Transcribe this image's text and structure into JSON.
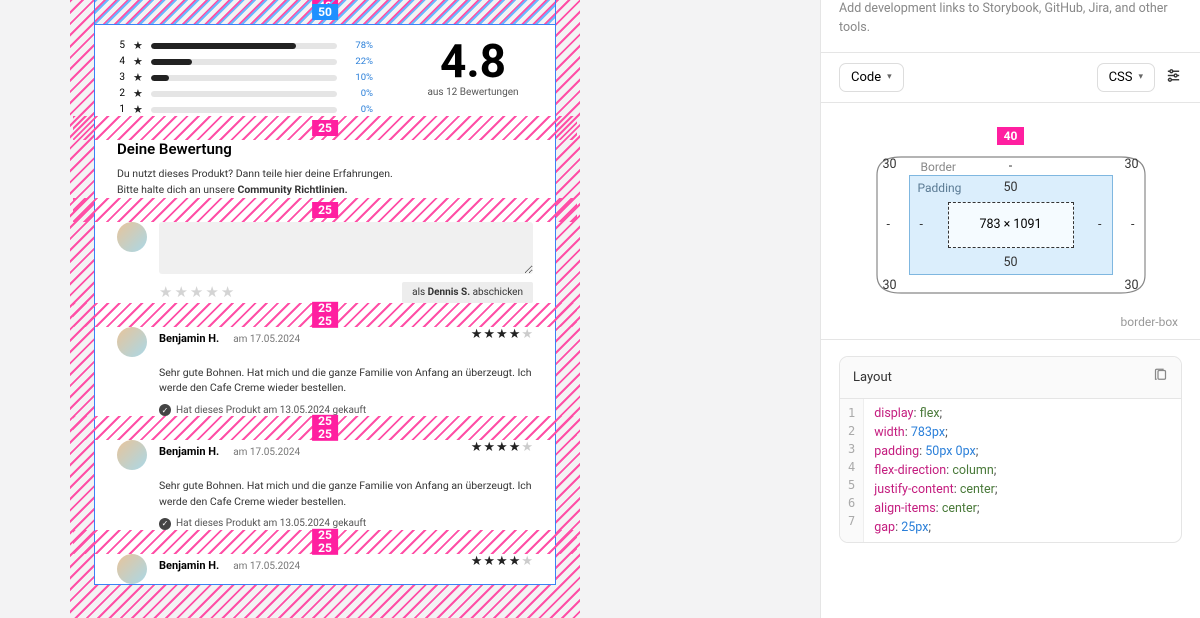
{
  "spacing_labels": {
    "outer_top": "40",
    "frame_top": "50",
    "gap1": "25",
    "gap2": "25",
    "gap3_a": "25",
    "gap3_b": "25",
    "gap4_a": "25",
    "gap4_b": "25",
    "gap5_a": "25",
    "gap5_b": "25",
    "inspector_top": "40"
  },
  "rating": {
    "bars": [
      {
        "label": "5",
        "pct": "78%",
        "fill": 78
      },
      {
        "label": "4",
        "pct": "22%",
        "fill": 22
      },
      {
        "label": "3",
        "pct": "10%",
        "fill": 10
      },
      {
        "label": "2",
        "pct": "0%",
        "fill": 0
      },
      {
        "label": "1",
        "pct": "0%",
        "fill": 0
      }
    ],
    "score": "4.8",
    "score_sub": "aus 12 Bewertungen"
  },
  "your_review": {
    "title": "Deine Bewertung",
    "text1": "Du nutzt dieses Produkt? Dann teile hier deine Erfahrungen.",
    "text2_a": "Bitte halte dich an unsere ",
    "text2_b": "Community Richtlinien.",
    "submit_pre": "als ",
    "submit_name": "Dennis S.",
    "submit_post": " abschicken"
  },
  "reviews": [
    {
      "name": "Benjamin H.",
      "date": "am 17.05.2024",
      "stars": 4,
      "body": "Sehr gute Bohnen. Hat mich und die ganze Familie von Anfang an überzeugt. Ich werde den Cafe Creme wieder bestellen.",
      "verified": "Hat dieses Produkt am 13.05.2024 gekauft"
    },
    {
      "name": "Benjamin H.",
      "date": "am 17.05.2024",
      "stars": 4,
      "body": "Sehr gute Bohnen. Hat mich und die ganze Familie von Anfang an überzeugt. Ich werde den Cafe Creme wieder bestellen.",
      "verified": "Hat dieses Produkt am 13.05.2024 gekauft"
    },
    {
      "name": "Benjamin H.",
      "date": "am 17.05.2024",
      "stars": 4,
      "body": "",
      "verified": ""
    }
  ],
  "sidebar": {
    "top_hint": "Add development links to Storybook, GitHub, Jira, and other tools.",
    "code_label": "Code",
    "css_label": "CSS",
    "box": {
      "border_label": "Border",
      "padding_label": "Padding",
      "border_top": "-",
      "border_right": "-",
      "border_bottom": "-",
      "border_left": "-",
      "corner_tl": "30",
      "corner_tr": "30",
      "corner_bl": "30",
      "corner_br": "30",
      "pad_top": "50",
      "pad_right": "-",
      "pad_bottom": "50",
      "pad_left": "-",
      "inner": "783 × 1091",
      "sizing": "border-box"
    },
    "layout_title": "Layout",
    "css": [
      {
        "n": "1",
        "prop": "display",
        "val": "flex"
      },
      {
        "n": "2",
        "prop": "width",
        "val_num": "783px"
      },
      {
        "n": "3",
        "prop": "padding",
        "val_num": "50px 0px"
      },
      {
        "n": "4",
        "prop": "flex-direction",
        "val": "column"
      },
      {
        "n": "5",
        "prop": "justify-content",
        "val": "center"
      },
      {
        "n": "6",
        "prop": "align-items",
        "val": "center"
      },
      {
        "n": "7",
        "prop": "gap",
        "val_num": "25px"
      }
    ]
  }
}
